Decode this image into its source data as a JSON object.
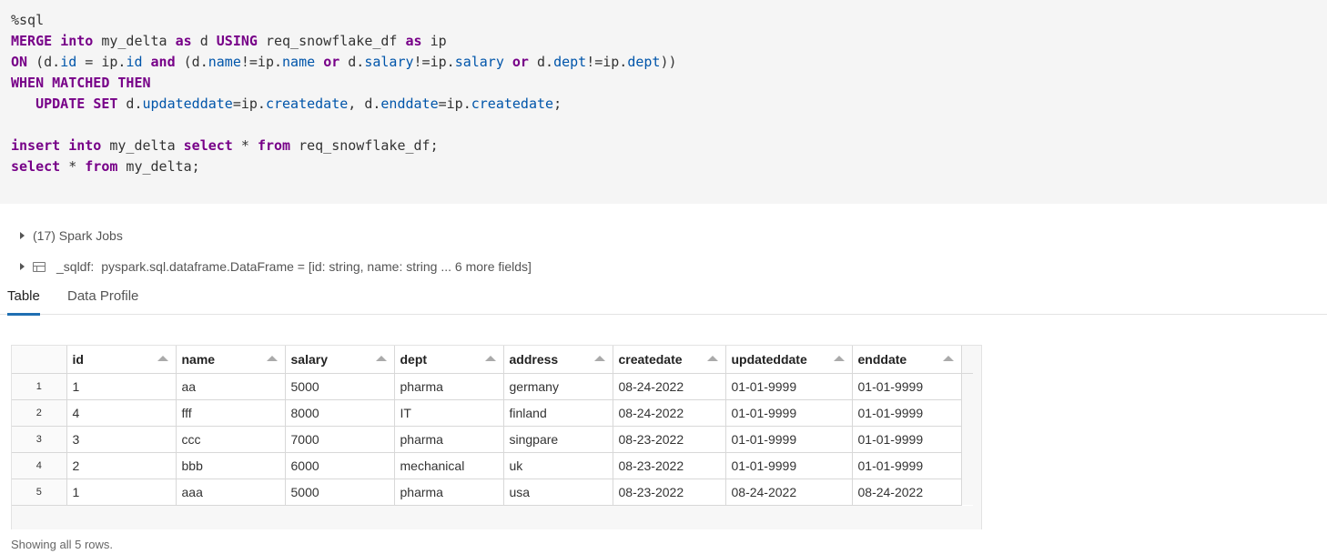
{
  "code": {
    "lines": [
      [
        {
          "t": "%sql",
          "c": "plain"
        }
      ],
      [
        {
          "t": "MERGE",
          "c": "kw"
        },
        {
          "t": " ",
          "c": "plain"
        },
        {
          "t": "into",
          "c": "kw"
        },
        {
          "t": " my_delta ",
          "c": "plain"
        },
        {
          "t": "as",
          "c": "kw"
        },
        {
          "t": " d ",
          "c": "plain"
        },
        {
          "t": "USING",
          "c": "kw"
        },
        {
          "t": " req_snowflake_df ",
          "c": "plain"
        },
        {
          "t": "as",
          "c": "kw"
        },
        {
          "t": " ip",
          "c": "plain"
        }
      ],
      [
        {
          "t": "ON",
          "c": "kw"
        },
        {
          "t": " (d.",
          "c": "plain"
        },
        {
          "t": "id",
          "c": "ident"
        },
        {
          "t": " = ip.",
          "c": "plain"
        },
        {
          "t": "id",
          "c": "ident"
        },
        {
          "t": " ",
          "c": "plain"
        },
        {
          "t": "and",
          "c": "kw"
        },
        {
          "t": " (d.",
          "c": "plain"
        },
        {
          "t": "name",
          "c": "ident"
        },
        {
          "t": "!=ip.",
          "c": "plain"
        },
        {
          "t": "name",
          "c": "ident"
        },
        {
          "t": " ",
          "c": "plain"
        },
        {
          "t": "or",
          "c": "kw"
        },
        {
          "t": " d.",
          "c": "plain"
        },
        {
          "t": "salary",
          "c": "ident"
        },
        {
          "t": "!=ip.",
          "c": "plain"
        },
        {
          "t": "salary",
          "c": "ident"
        },
        {
          "t": " ",
          "c": "plain"
        },
        {
          "t": "or",
          "c": "kw"
        },
        {
          "t": " d.",
          "c": "plain"
        },
        {
          "t": "dept",
          "c": "ident"
        },
        {
          "t": "!=ip.",
          "c": "plain"
        },
        {
          "t": "dept",
          "c": "ident"
        },
        {
          "t": "))",
          "c": "plain"
        }
      ],
      [
        {
          "t": "WHEN",
          "c": "kw"
        },
        {
          "t": " ",
          "c": "plain"
        },
        {
          "t": "MATCHED",
          "c": "kw"
        },
        {
          "t": " ",
          "c": "plain"
        },
        {
          "t": "THEN",
          "c": "kw"
        }
      ],
      [
        {
          "t": "   ",
          "c": "plain"
        },
        {
          "t": "UPDATE",
          "c": "kw"
        },
        {
          "t": " ",
          "c": "plain"
        },
        {
          "t": "SET",
          "c": "kw"
        },
        {
          "t": " d.",
          "c": "plain"
        },
        {
          "t": "updateddate",
          "c": "ident"
        },
        {
          "t": "=ip.",
          "c": "plain"
        },
        {
          "t": "createdate",
          "c": "ident"
        },
        {
          "t": ", d.",
          "c": "plain"
        },
        {
          "t": "enddate",
          "c": "ident"
        },
        {
          "t": "=ip.",
          "c": "plain"
        },
        {
          "t": "createdate",
          "c": "ident"
        },
        {
          "t": ";",
          "c": "plain"
        }
      ],
      [
        {
          "t": "",
          "c": "plain"
        }
      ],
      [
        {
          "t": "insert",
          "c": "kw"
        },
        {
          "t": " ",
          "c": "plain"
        },
        {
          "t": "into",
          "c": "kw"
        },
        {
          "t": " my_delta ",
          "c": "plain"
        },
        {
          "t": "select",
          "c": "kw"
        },
        {
          "t": " * ",
          "c": "plain"
        },
        {
          "t": "from",
          "c": "kw"
        },
        {
          "t": " req_snowflake_df;",
          "c": "plain"
        }
      ],
      [
        {
          "t": "select",
          "c": "kw"
        },
        {
          "t": " * ",
          "c": "plain"
        },
        {
          "t": "from",
          "c": "kw"
        },
        {
          "t": " my_delta;",
          "c": "plain"
        }
      ]
    ]
  },
  "output": {
    "jobs_label": "(17) Spark Jobs",
    "df_var": "_sqldf:",
    "df_type": "pyspark.sql.dataframe.DataFrame = [id: string, name: string ... 6 more fields]"
  },
  "tabs": [
    {
      "label": "Table",
      "active": true
    },
    {
      "label": "Data Profile",
      "active": false
    }
  ],
  "table": {
    "columns": [
      "id",
      "name",
      "salary",
      "dept",
      "address",
      "createdate",
      "updateddate",
      "enddate"
    ],
    "rows": [
      {
        "num": "1",
        "cells": [
          "1",
          "aa",
          "5000",
          "pharma",
          "germany",
          "08-24-2022",
          "01-01-9999",
          "01-01-9999"
        ]
      },
      {
        "num": "2",
        "cells": [
          "4",
          "fff",
          "8000",
          "IT",
          "finland",
          "08-24-2022",
          "01-01-9999",
          "01-01-9999"
        ]
      },
      {
        "num": "3",
        "cells": [
          "3",
          "ccc",
          "7000",
          "pharma",
          "singpare",
          "08-23-2022",
          "01-01-9999",
          "01-01-9999"
        ]
      },
      {
        "num": "4",
        "cells": [
          "2",
          "bbb",
          "6000",
          "mechanical",
          "uk",
          "08-23-2022",
          "01-01-9999",
          "01-01-9999"
        ]
      },
      {
        "num": "5",
        "cells": [
          "1",
          "aaa",
          "5000",
          "pharma",
          "usa",
          "08-23-2022",
          "08-24-2022",
          "08-24-2022"
        ]
      }
    ]
  },
  "footer": "Showing all 5 rows.",
  "colors": {
    "keyword": "#770088",
    "identifier": "#0055aa",
    "active_tab_underline": "#1f6fb2"
  }
}
